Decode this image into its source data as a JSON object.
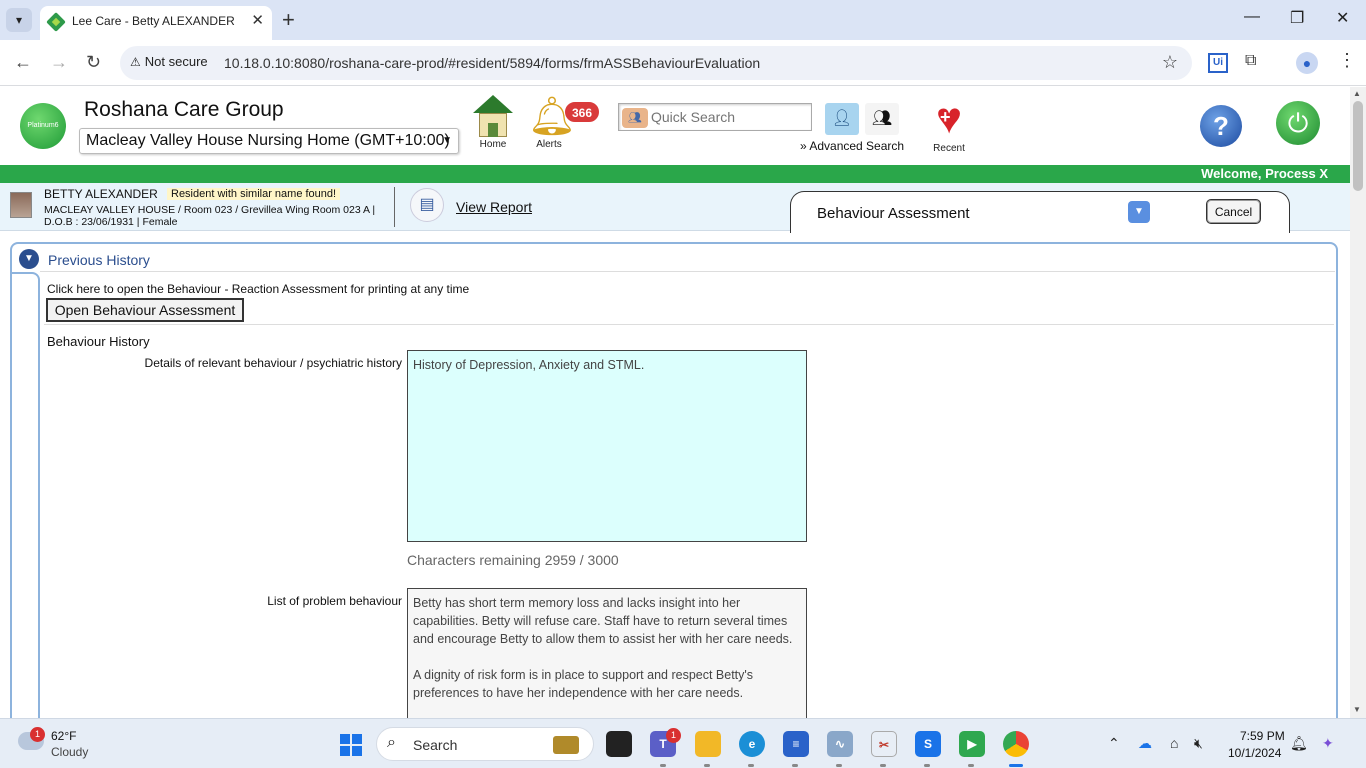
{
  "browser": {
    "tab_title": "Lee Care - Betty ALEXANDER - l",
    "new_tab": "+",
    "not_secure": "Not secure",
    "url": "10.18.0.10:8080/roshana-care-prod/#resident/5894/forms/frmASSBehaviourEvaluation",
    "uipath_label": "Ui"
  },
  "header": {
    "logo_text": "Platinum6",
    "org_name": "Roshana Care Group",
    "facility": "Macleay Valley House Nursing Home (GMT+10:00)",
    "home_label": "Home",
    "alerts_label": "Alerts",
    "alerts_count": "366",
    "quick_search_placeholder": "Quick Search",
    "advanced_search": "» Advanced Search",
    "recent_label": "Recent",
    "welcome": "Welcome, Process X"
  },
  "resident": {
    "name": "BETTY ALEXANDER",
    "warning": "Resident with similar name found!",
    "details": "MACLEAY VALLEY HOUSE / Room 023 / Grevillea Wing Room 023 A | D.O.B : 23/06/1931 | Female",
    "view_report": "View Report",
    "form_title": "Behaviour Assessment",
    "cancel": "Cancel"
  },
  "panel": {
    "title": "Previous History",
    "hint": "Click here to open the Behaviour - Reaction Assessment for printing at any time",
    "open_button": "Open Behaviour Assessment",
    "section": "Behaviour History",
    "field1_label": "Details of relevant behaviour / psychiatric history",
    "field1_value": "History of Depression, Anxiety and STML.",
    "chars_remaining": "Characters remaining 2959 / 3000",
    "field2_label": "List of problem behaviour",
    "field2_value": "Betty has short term memory loss and lacks insight into her capabilities. Betty will refuse care. Staff have to return several times and encourage Betty to allow them to assist her with her care needs.\n\nA dignity of risk form is in place to support and respect Betty's preferences to have her independence with her care needs."
  },
  "taskbar": {
    "weather_badge": "1",
    "temperature": "62°F",
    "condition": "Cloudy",
    "search": "Search",
    "teams_badge": "1",
    "time": "7:59 PM",
    "date": "10/1/2024"
  },
  "colors": {
    "green_bar": "#2aa74a",
    "panel_border": "#8db3dd",
    "textarea_bg": "#dcfffd",
    "alert_badge": "#d93a3a"
  }
}
